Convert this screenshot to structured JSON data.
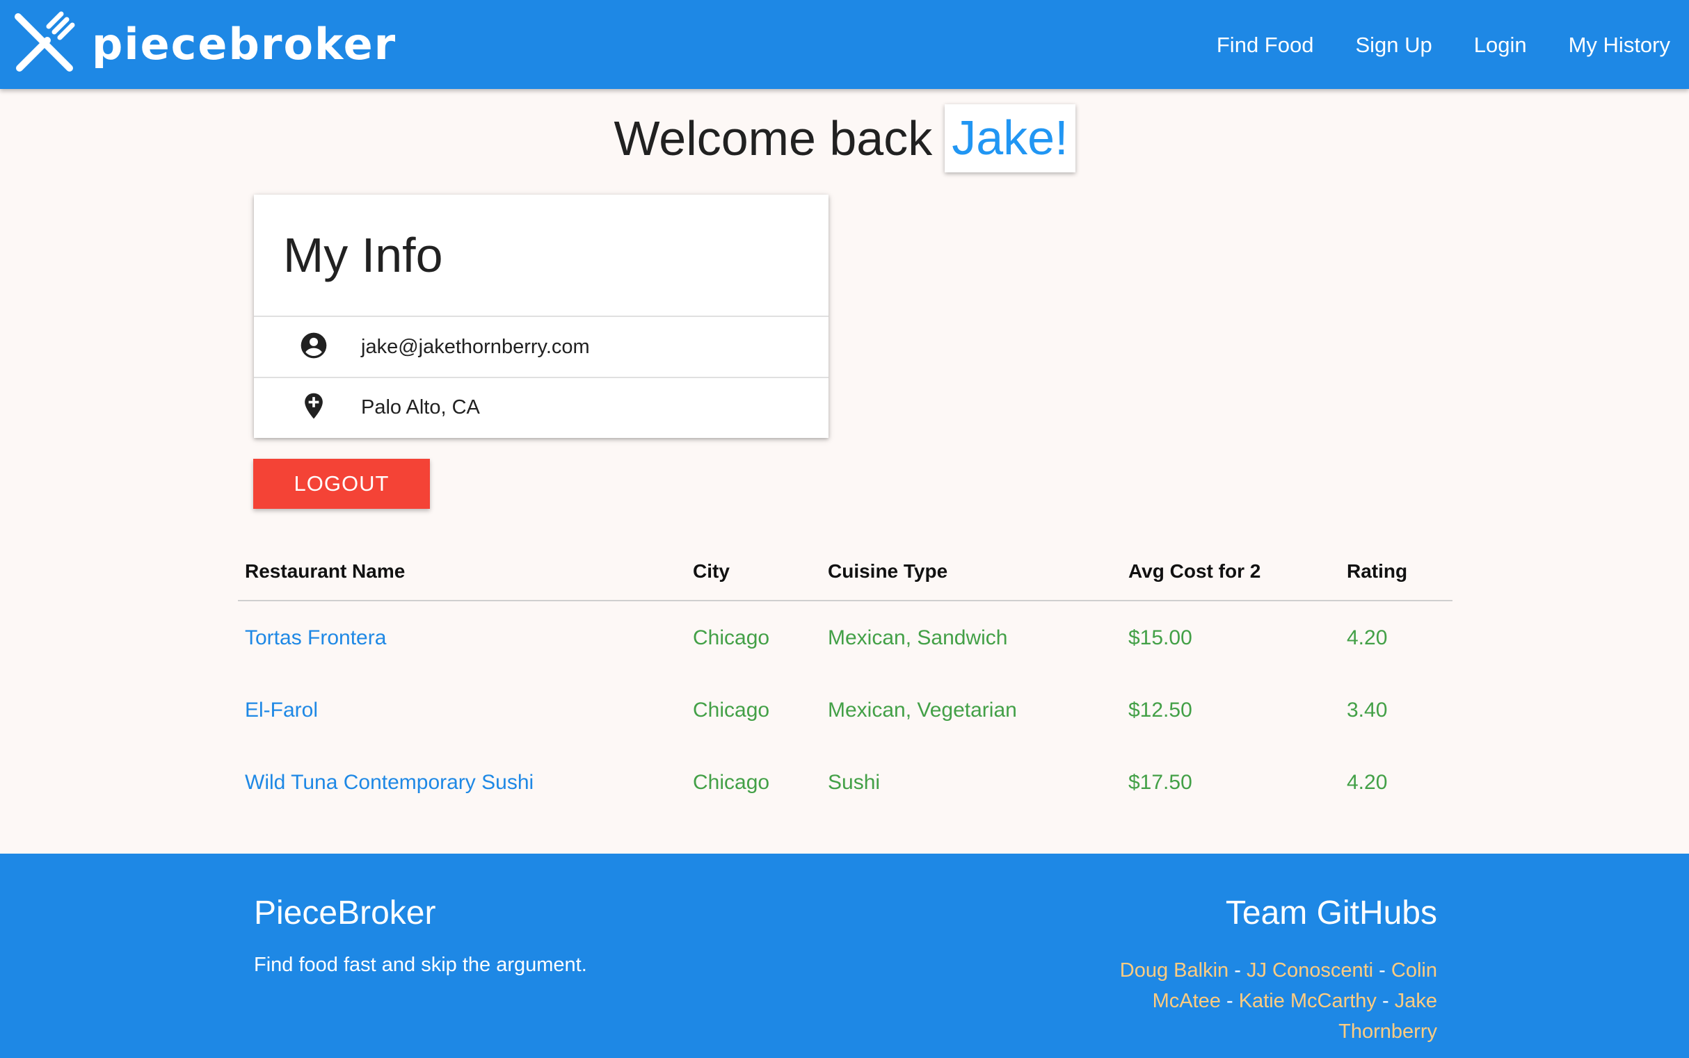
{
  "nav": {
    "brand": "piecebroker",
    "links": [
      "Find Food",
      "Sign Up",
      "Login",
      "My History"
    ]
  },
  "welcome": {
    "prefix": "Welcome back",
    "name": "Jake!"
  },
  "info": {
    "title": "My Info",
    "email": "jake@jakethornberry.com",
    "location": "Palo Alto, CA"
  },
  "logout_label": "LOGOUT",
  "table": {
    "headers": [
      "Restaurant Name",
      "City",
      "Cuisine Type",
      "Avg Cost for 2",
      "Rating"
    ],
    "rows": [
      [
        "Tortas Frontera",
        "Chicago",
        "Mexican, Sandwich",
        "$15.00",
        "4.20"
      ],
      [
        "El-Farol",
        "Chicago",
        "Mexican, Vegetarian",
        "$12.50",
        "3.40"
      ],
      [
        "Wild Tuna Contemporary Sushi",
        "Chicago",
        "Sushi",
        "$17.50",
        "4.20"
      ]
    ]
  },
  "footer": {
    "title": "PieceBroker",
    "tagline": "Find food fast and skip the argument.",
    "team_title": "Team GitHubs",
    "members": [
      "Doug Balkin",
      "JJ Conoscenti",
      "Colin McAtee",
      "Katie McCarthy",
      "Jake Thornberry"
    ],
    "separator": "-"
  },
  "colors": {
    "primary": "#1e88e5",
    "accent_name": "#2196f3",
    "logout": "#f44336",
    "table_text": "#43a047",
    "footer_link": "#ffcc80"
  },
  "icons": {
    "brand": "fork-knife-icon",
    "email": "account-circle-icon",
    "location": "map-pin-plus-icon"
  }
}
